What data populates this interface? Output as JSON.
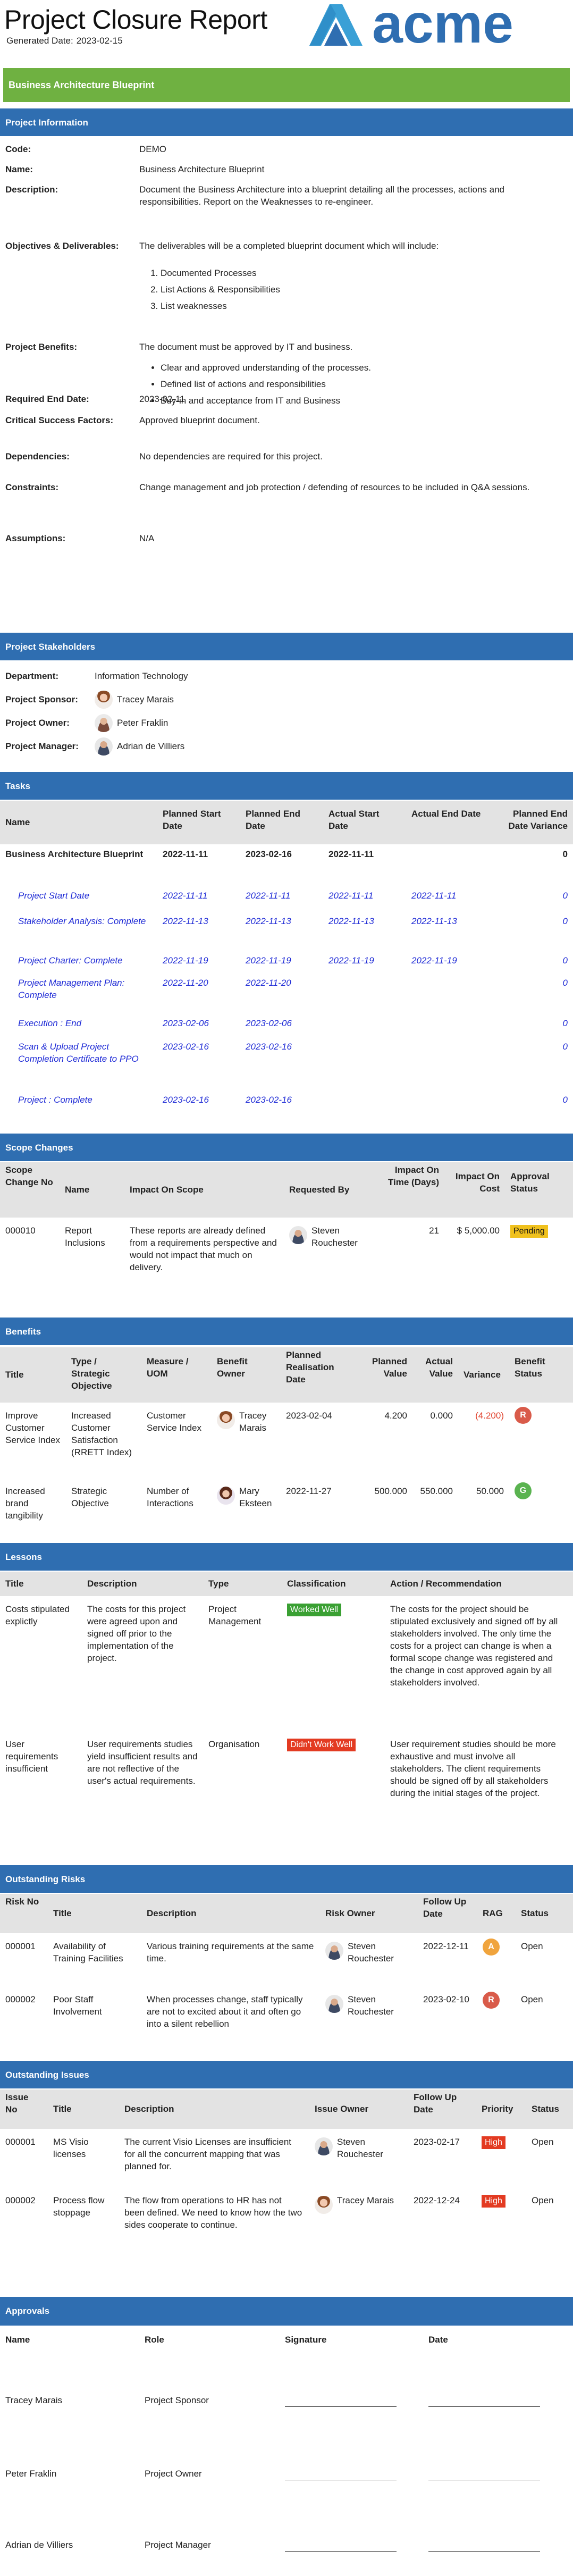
{
  "header": {
    "title": "Project Closure Report",
    "generated_label": "Generated Date:",
    "generated_date": "2023-02-15",
    "logo_text": "acme",
    "brand_color": "#2f6eb1"
  },
  "project_banner": "Business Architecture Blueprint",
  "project_info": {
    "section": "Project Information",
    "code_label": "Code:",
    "code": "DEMO",
    "name_label": "Name:",
    "name": "Business Architecture Blueprint",
    "description_label": "Description:",
    "description": "Document the Business Architecture into a blueprint detailing all the processes, actions and responsibilities. Report on the Weaknesses to re-engineer.",
    "objectives_label": "Objectives & Deliverables:",
    "objectives_intro": "The deliverables will be a completed blueprint document which will include:",
    "objectives_items": [
      "Documented Processes",
      "List Actions & Responsibilities",
      "List weaknesses"
    ],
    "benefits_label": "Project Benefits:",
    "benefits_intro": "The document must be approved by IT and business.",
    "benefits_items": [
      "Clear and approved understanding of the processes.",
      "Defined list of actions and responsibilities",
      "Buy-in and acceptance from IT and Business"
    ],
    "required_end_label": "Required End Date:",
    "required_end": "2023-02-11",
    "csf_label": "Critical Success Factors:",
    "csf": "Approved blueprint document.",
    "dependencies_label": "Dependencies:",
    "dependencies": "No dependencies are required for this project.",
    "constraints_label": "Constraints:",
    "constraints": "Change management and job protection / defending of resources to be included in Q&A sessions.",
    "assumptions_label": "Assumptions:",
    "assumptions": "N/A"
  },
  "stakeholders": {
    "section": "Project Stakeholders",
    "department_label": "Department:",
    "department": "Information Technology",
    "sponsor_label": "Project Sponsor:",
    "sponsor": "Tracey Marais",
    "owner_label": "Project Owner:",
    "owner": "Peter Fraklin",
    "manager_label": "Project Manager:",
    "manager": "Adrian de Villiers"
  },
  "tasks": {
    "section": "Tasks",
    "headers": [
      "Name",
      "Planned Start Date",
      "Planned End Date",
      "Actual Start Date",
      "Actual End Date",
      "Planned End Date Variance"
    ],
    "summary": {
      "name": "Business Architecture Blueprint",
      "ps": "2022-11-11",
      "pe": "2023-02-16",
      "as": "2022-11-11",
      "ae": "",
      "var": "0"
    },
    "rows": [
      {
        "name": "Project Start Date",
        "ps": "2022-11-11",
        "pe": "2022-11-11",
        "as": "2022-11-11",
        "ae": "2022-11-11",
        "var": "0"
      },
      {
        "name": "Stakeholder Analysis: Complete",
        "ps": "2022-11-13",
        "pe": "2022-11-13",
        "as": "2022-11-13",
        "ae": "2022-11-13",
        "var": "0"
      },
      {
        "name": "Project Charter: Complete",
        "ps": "2022-11-19",
        "pe": "2022-11-19",
        "as": "2022-11-19",
        "ae": "2022-11-19",
        "var": "0"
      },
      {
        "name": "Project Management Plan: Complete",
        "ps": "2022-11-20",
        "pe": "2022-11-20",
        "as": "",
        "ae": "",
        "var": "0"
      },
      {
        "name": "Execution : End",
        "ps": "2023-02-06",
        "pe": "2023-02-06",
        "as": "",
        "ae": "",
        "var": "0"
      },
      {
        "name": "Scan & Upload Project Completion Certificate to PPO",
        "ps": "2023-02-16",
        "pe": "2023-02-16",
        "as": "",
        "ae": "",
        "var": "0"
      },
      {
        "name": "Project : Complete",
        "ps": "2023-02-16",
        "pe": "2023-02-16",
        "as": "",
        "ae": "",
        "var": "0"
      }
    ]
  },
  "scope": {
    "section": "Scope Changes",
    "headers": [
      "Scope Change No",
      "Name",
      "Impact On Scope",
      "Requested By",
      "Impact On Time (Days)",
      "Impact On Cost",
      "Approval Status"
    ],
    "rows": [
      {
        "no": "000010",
        "name": "Report Inclusions",
        "impact": "These reports are already defined from a requirements perspective and would not impact that much on delivery.",
        "by": "Steven Rouchester",
        "time": "21",
        "cost": "$ 5,000.00",
        "status": "Pending"
      }
    ]
  },
  "benefits": {
    "section": "Benefits",
    "headers": [
      "Title",
      "Type / Strategic Objective",
      "Measure / UOM",
      "Benefit Owner",
      "Planned Realisation Date",
      "Planned Value",
      "Actual Value",
      "Variance",
      "Benefit Status"
    ],
    "rows": [
      {
        "title": "Improve Customer Service Index",
        "type": "Increased Customer Satisfaction (RRETT Index)",
        "measure": "Customer Service Index",
        "owner": "Tracey Marais",
        "date": "2023-02-04",
        "planned": "4.200",
        "actual": "0.000",
        "variance": "(4.200)",
        "status": "R"
      },
      {
        "title": "Increased brand tangibility",
        "type": "Strategic Objective",
        "measure": "Number of Interactions",
        "owner": "Mary Eksteen",
        "date": "2022-11-27",
        "planned": "500.000",
        "actual": "550.000",
        "variance": "50.000",
        "status": "G"
      }
    ]
  },
  "lessons": {
    "section": "Lessons",
    "headers": [
      "Title",
      "Description",
      "Type",
      "Classification",
      "Action / Recommendation"
    ],
    "rows": [
      {
        "title": "Costs stipulated explictly",
        "desc": "The costs for this project were agreed upon and signed off prior to the implementation of the project.",
        "type": "Project Management",
        "class": "Worked Well",
        "action": "The costs for the project should be stipulated exclusively and signed off by all stakeholders involved. The only time the costs for a project can change is when a formal scope change was registered and the change in cost approved again by all stakeholders involved."
      },
      {
        "title": "User requirements insufficient",
        "desc": "User requirements studies yield insufficient results and are not reflective of the user's actual requirements.",
        "type": "Organisation",
        "class": "Didn't Work Well",
        "action": "User requirement studies should be more exhaustive and must involve all stakeholders. The client requirements should be signed off by all stakeholders during the initial stages of the project."
      }
    ]
  },
  "risks": {
    "section": "Outstanding Risks",
    "headers": [
      "Risk No",
      "Title",
      "Description",
      "Risk Owner",
      "Follow Up Date",
      "RAG",
      "Status"
    ],
    "rows": [
      {
        "no": "000001",
        "title": "Availability of Training Facilities",
        "desc": "Various training requirements at the same time.",
        "owner": "Steven Rouchester",
        "date": "2022-12-11",
        "rag": "A",
        "status": "Open"
      },
      {
        "no": "000002",
        "title": "Poor Staff Involvement",
        "desc": "When processes change, staff typically are not to excited about it and often go into a silent rebellion",
        "owner": "Steven Rouchester",
        "date": "2023-02-10",
        "rag": "R",
        "status": "Open"
      }
    ]
  },
  "issues": {
    "section": "Outstanding Issues",
    "headers": [
      "Issue No",
      "Title",
      "Description",
      "Issue Owner",
      "Follow Up Date",
      "Priority",
      "Status"
    ],
    "rows": [
      {
        "no": "000001",
        "title": "MS Visio licenses",
        "desc": "The current Visio Licenses are insufficient for all the concurrent mapping that was planned for.",
        "owner": "Steven Rouchester",
        "date": "2023-02-17",
        "priority": "High",
        "status": "Open"
      },
      {
        "no": "000002",
        "title": "Process flow stoppage",
        "desc": "The flow from operations to HR has not been defined. We need to know how the two sides cooperate to continue.",
        "owner": "Tracey Marais",
        "date": "2022-12-24",
        "priority": "High",
        "status": "Open"
      }
    ]
  },
  "approvals": {
    "section": "Approvals",
    "headers": [
      "Name",
      "Role",
      "Signature",
      "Date"
    ],
    "rows": [
      {
        "name": "Tracey Marais",
        "role": "Project Sponsor"
      },
      {
        "name": "Peter Fraklin",
        "role": "Project Owner"
      },
      {
        "name": "Adrian de Villiers",
        "role": "Project Manager"
      }
    ]
  }
}
